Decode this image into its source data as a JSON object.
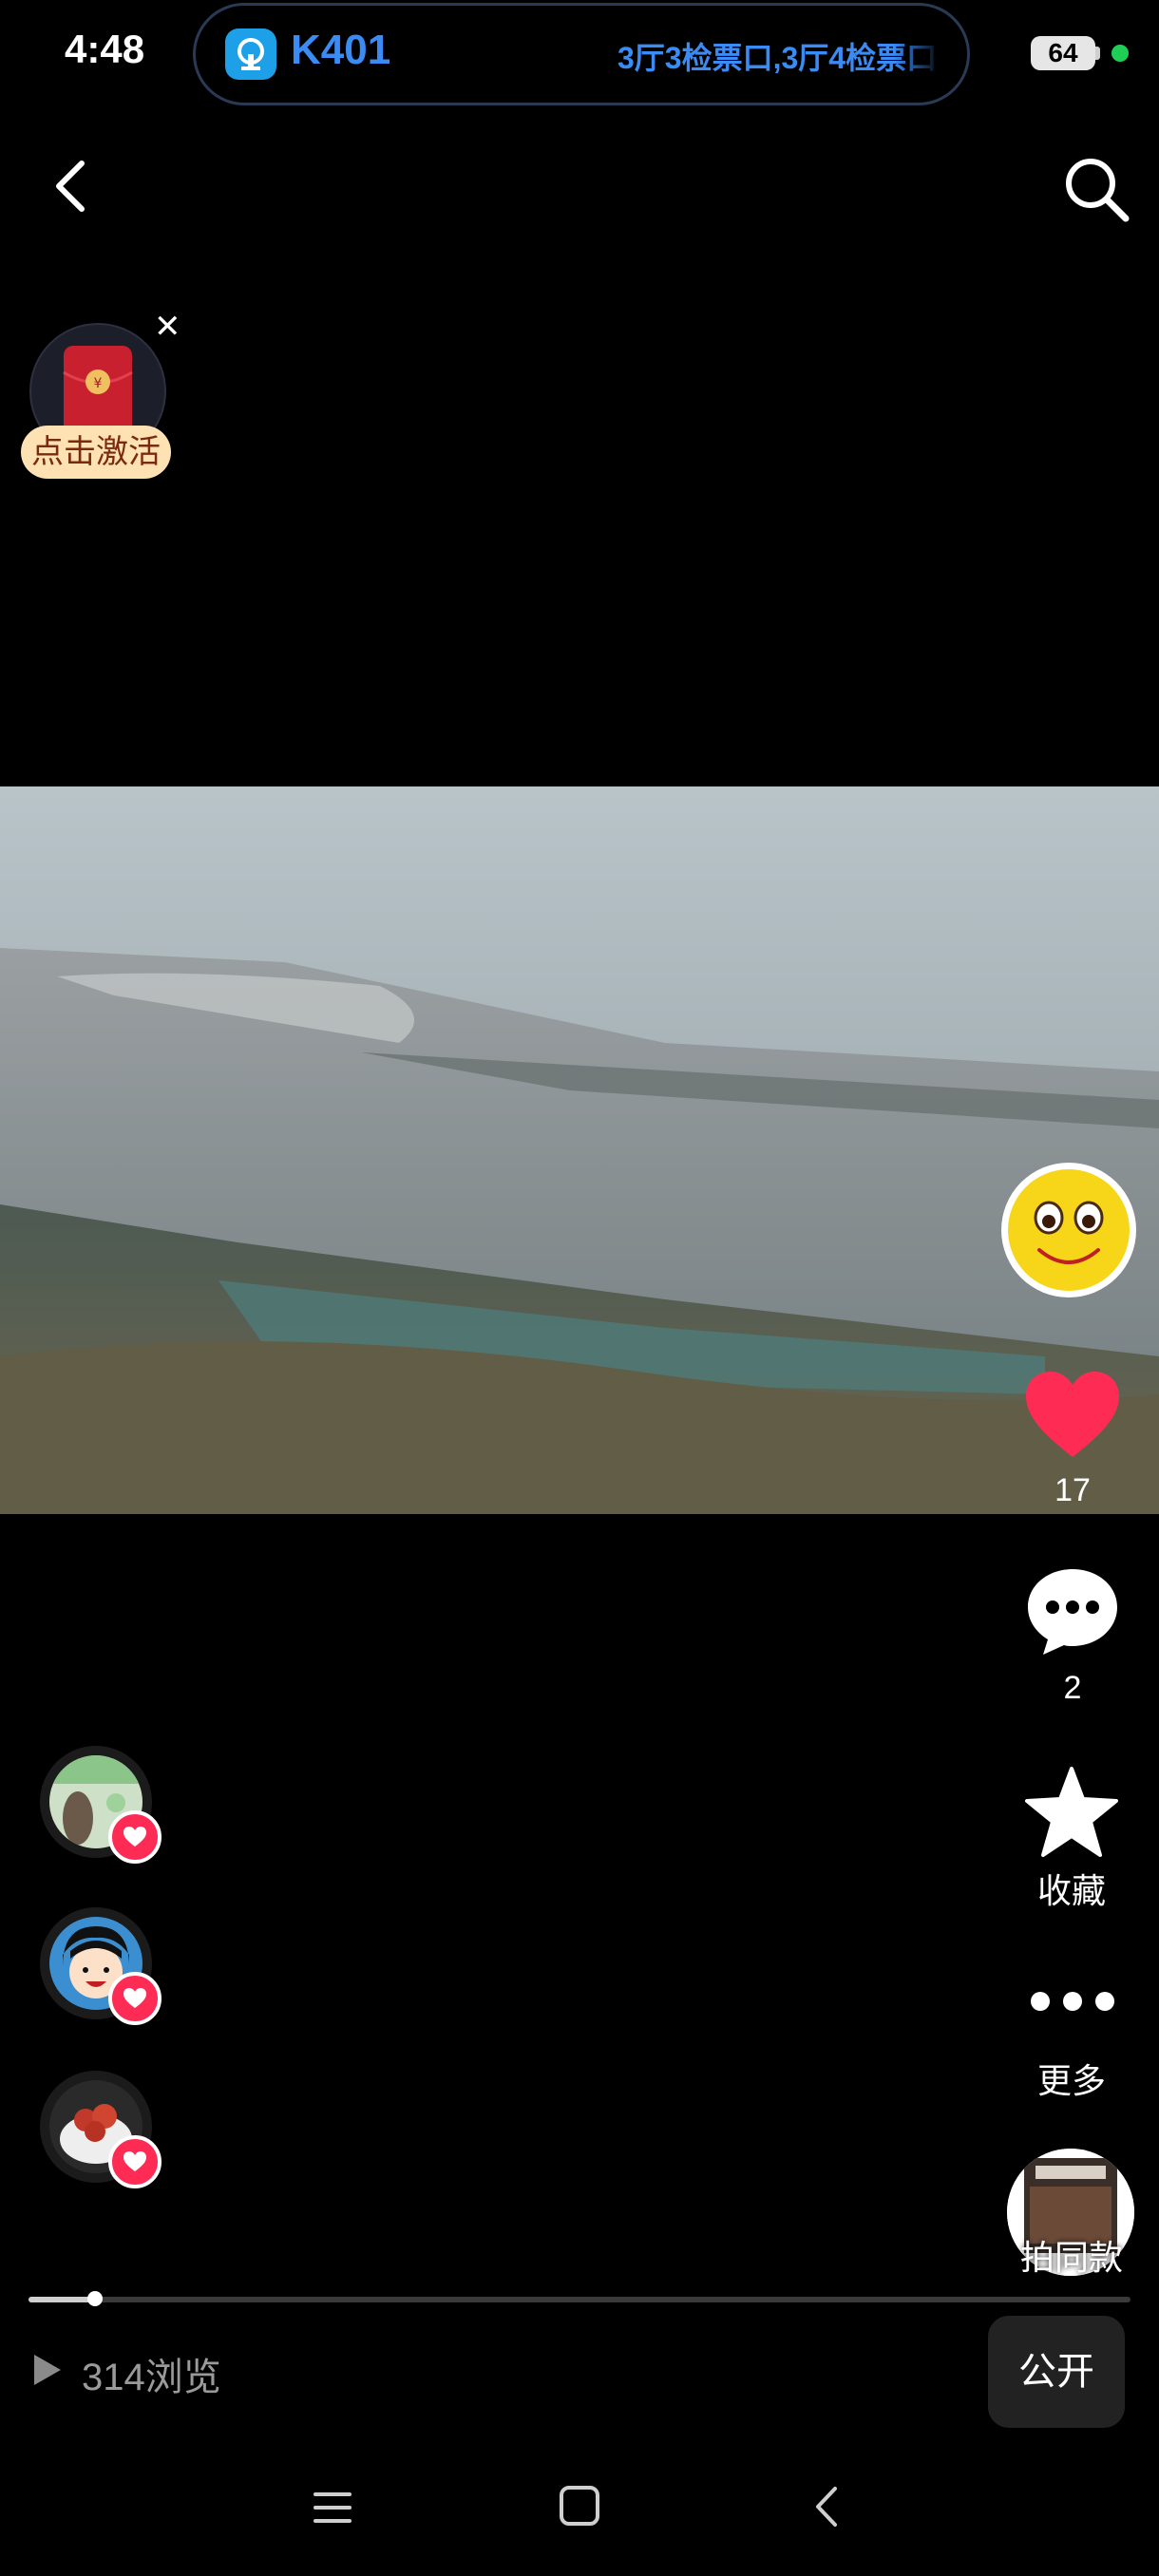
{
  "status_bar": {
    "time": "4:48",
    "notification": {
      "train_number": "K401",
      "message": "3厅3检票口,3厅4检票口"
    },
    "battery": "64"
  },
  "promo": {
    "label": "点击激活"
  },
  "actions": {
    "like_count": "17",
    "comment_count": "2",
    "favorite_label": "收藏",
    "more_label": "更多",
    "same_style_label": "拍同款"
  },
  "footer": {
    "views": "314浏览",
    "visibility": "公开",
    "progress": 0.06
  },
  "colors": {
    "accent_blue": "#3b8bf5",
    "like_red": "#fe2c55",
    "status_green": "#1fcf55"
  }
}
